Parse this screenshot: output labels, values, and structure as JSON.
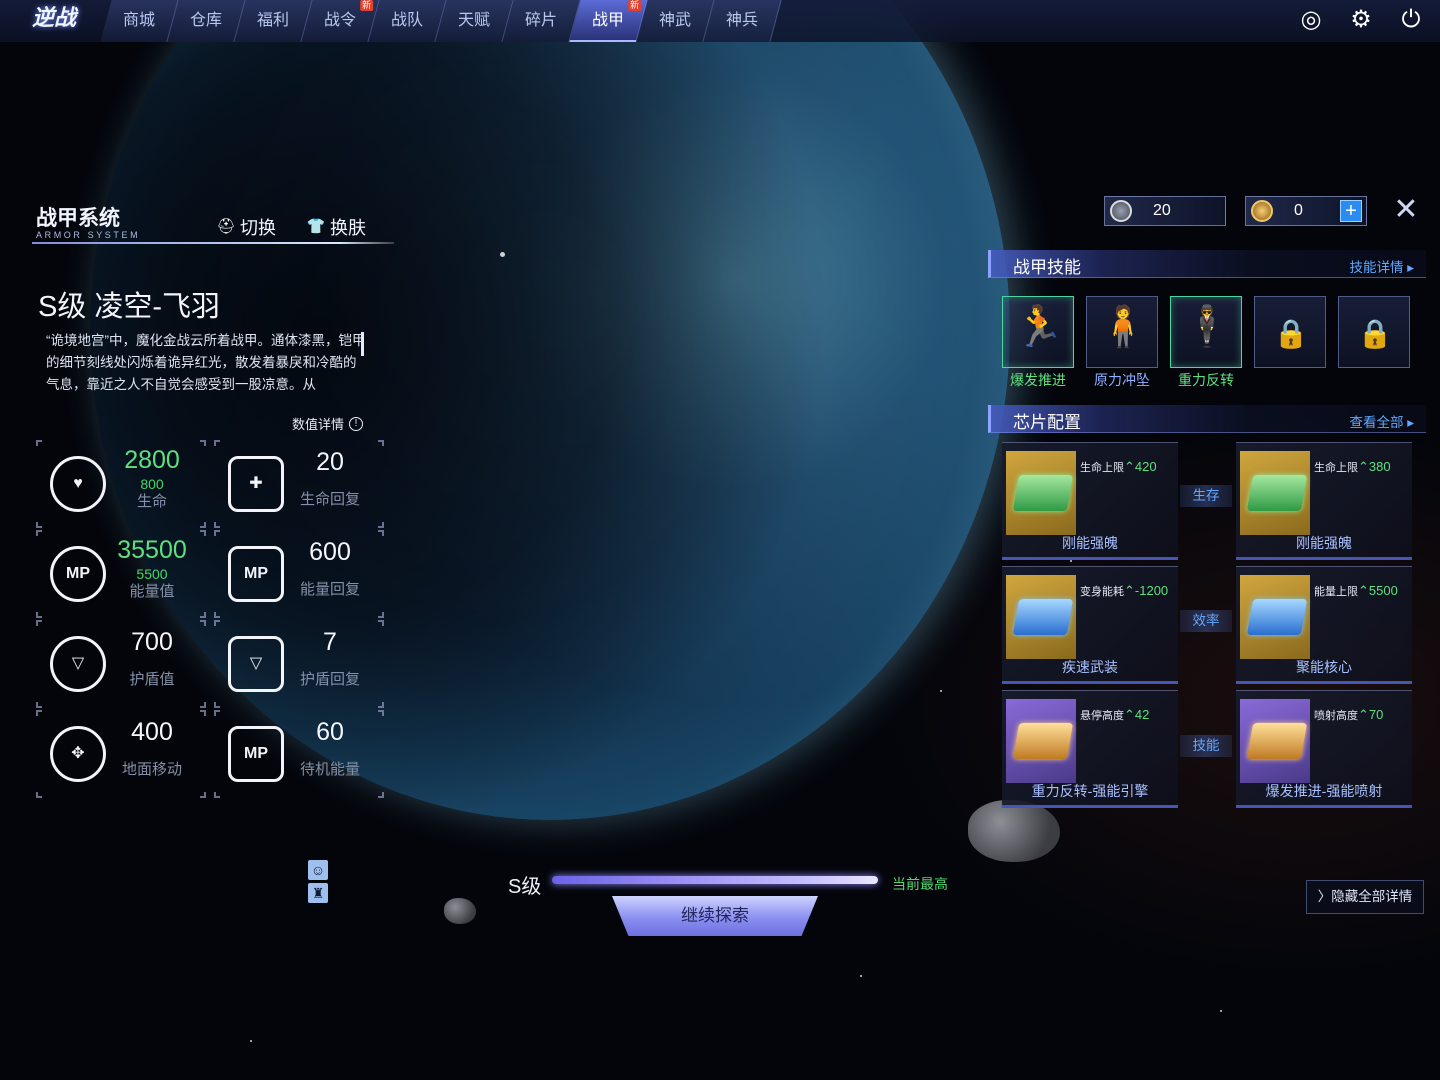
{
  "nav": {
    "logo": "逆战",
    "items": [
      {
        "label": "商城",
        "badge": ""
      },
      {
        "label": "仓库",
        "badge": ""
      },
      {
        "label": "福利",
        "badge": ""
      },
      {
        "label": "战令",
        "badge": "新"
      },
      {
        "label": "战队",
        "badge": ""
      },
      {
        "label": "天赋",
        "badge": ""
      },
      {
        "label": "碎片",
        "badge": ""
      },
      {
        "label": "战甲",
        "badge": "新",
        "active": true
      },
      {
        "label": "神武",
        "badge": ""
      },
      {
        "label": "神兵",
        "badge": ""
      }
    ],
    "icons": [
      "target-icon",
      "gear-icon",
      "power-icon"
    ]
  },
  "armor": {
    "title": "战甲系统",
    "subtitle": "ARMOR SYSTEM",
    "switch_label": "切换",
    "skin_label": "换肤",
    "suit_name": "S级 凌空-飞羽",
    "description": "“诡境地宫”中，魔化金战云所着战甲。通体漆黑，铠甲的细节刻线处闪烁着诡异红光，散发着暴戾和冷酷的气息，靠近之人不自觉会感受到一股凉意。从",
    "detail_link": "数值详情"
  },
  "stats": [
    {
      "value": "2800",
      "sub": "800",
      "label": "生命",
      "icon": "health-icon",
      "green": true
    },
    {
      "value": "20",
      "sub": "",
      "label": "生命回复",
      "icon": "health-regen-icon",
      "green": false
    },
    {
      "value": "35500",
      "sub": "5500",
      "label": "能量值",
      "icon": "mp-icon",
      "green": true
    },
    {
      "value": "600",
      "sub": "",
      "label": "能量回复",
      "icon": "mp-regen-icon",
      "green": false
    },
    {
      "value": "700",
      "sub": "",
      "label": "护盾值",
      "icon": "shield-icon",
      "green": false
    },
    {
      "value": "7",
      "sub": "",
      "label": "护盾回复",
      "icon": "shield-regen-icon",
      "green": false
    },
    {
      "value": "400",
      "sub": "",
      "label": "地面移动",
      "icon": "move-icon",
      "green": false
    },
    {
      "value": "60",
      "sub": "",
      "label": "待机能量",
      "icon": "idle-mp-icon",
      "green": false
    }
  ],
  "resources": {
    "silver": "20",
    "gold": "0",
    "plus": "+",
    "close": "✕"
  },
  "skills": {
    "title": "战甲技能",
    "link": "技能详情",
    "items": [
      {
        "name": "爆发推进",
        "active": true
      },
      {
        "name": "原力冲坠",
        "active": false
      },
      {
        "name": "重力反转",
        "active": true
      },
      {
        "name": "",
        "locked": true
      },
      {
        "name": "",
        "locked": true
      }
    ]
  },
  "chips": {
    "title": "芯片配置",
    "link": "查看全部",
    "groups": [
      "生存",
      "效率",
      "技能"
    ],
    "items": [
      {
        "stat": "生命上限",
        "value": "420",
        "name": "刚能强魄",
        "art": "gold",
        "gem": "green"
      },
      {
        "stat": "生命上限",
        "value": "380",
        "name": "刚能强魄",
        "art": "gold",
        "gem": "green"
      },
      {
        "stat": "变身能耗",
        "value": "-1200",
        "name": "疾速武装",
        "art": "gold",
        "gem": "blue"
      },
      {
        "stat": "能量上限",
        "value": "5500",
        "name": "聚能核心",
        "art": "gold",
        "gem": "blue"
      },
      {
        "stat": "悬停高度",
        "value": "42",
        "name": "重力反转-强能引擎",
        "art": "purple",
        "gem": "orange"
      },
      {
        "stat": "喷射高度",
        "value": "70",
        "name": "爆发推进-强能喷射",
        "art": "purple",
        "gem": "orange"
      }
    ]
  },
  "bottom": {
    "grade_label": "S级",
    "grade_best": "当前最高",
    "explore_label": "继续探索",
    "hide_label": "隐藏全部详情"
  }
}
